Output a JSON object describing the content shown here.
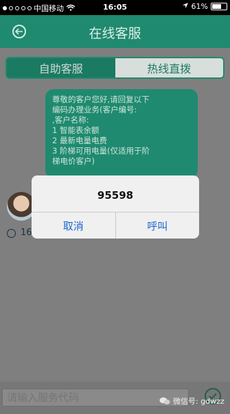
{
  "status_bar": {
    "carrier": "中国移动",
    "time": "16:05",
    "battery_text": "61%"
  },
  "header": {
    "title": "在线客服"
  },
  "tabs": [
    {
      "label": "自助客服",
      "active": false
    },
    {
      "label": "热线直拨",
      "active": true
    }
  ],
  "chat": {
    "bubble_lines": [
      "尊敬的客户您好,请回复以下",
      "编码办理业务(客户编号:",
      ",客户名称:",
      "1 智能表余额",
      "2 最新电量电费",
      "3 阶梯可用电量(仅适用于阶",
      "梯电价客户)"
    ],
    "message_time": "16"
  },
  "dialog": {
    "message": "95598",
    "cancel_label": "取消",
    "call_label": "呼叫"
  },
  "input_bar": {
    "placeholder": "请输入服务代码"
  },
  "watermark": {
    "text": "微信号: gdwzz"
  },
  "colors": {
    "accent": "#1f8a6f",
    "dialog_button": "#1a66d1"
  }
}
